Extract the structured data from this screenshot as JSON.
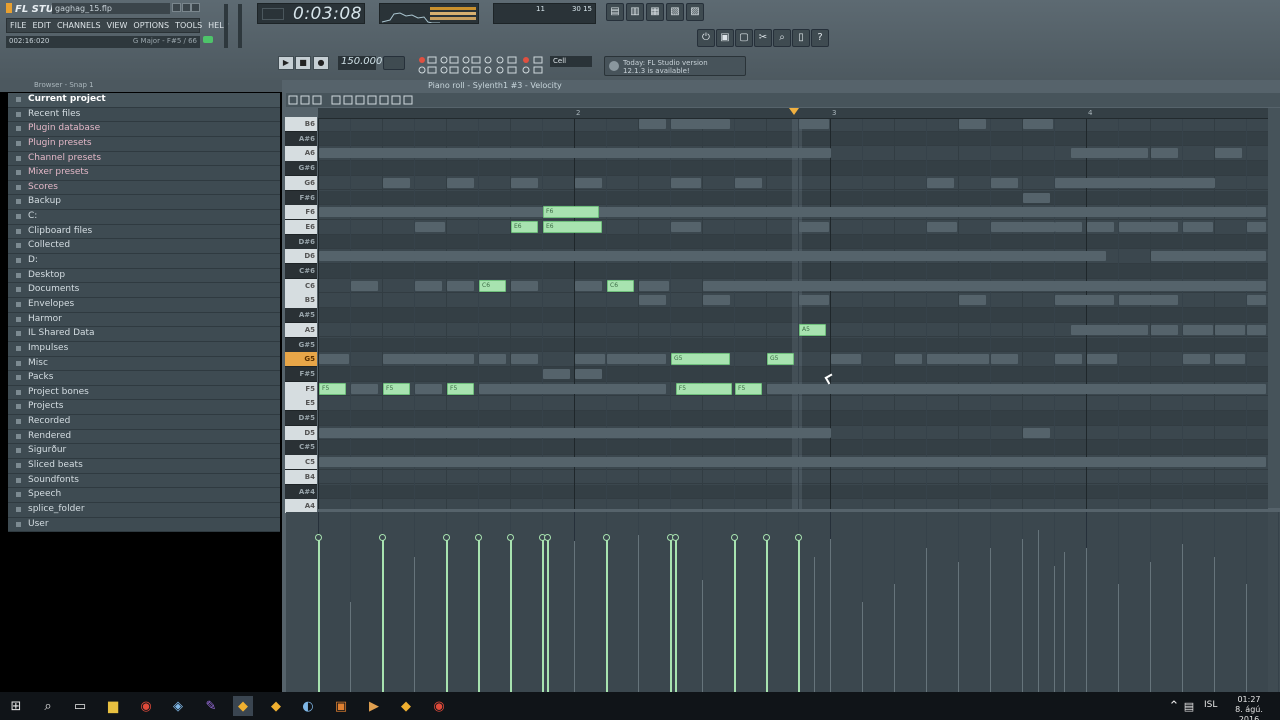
{
  "app": {
    "name": "FL STUDIO",
    "filename": "gaghag_15.flp",
    "menu": [
      "FILE",
      "EDIT",
      "CHANNELS",
      "VIEW",
      "OPTIONS",
      "TOOLS",
      "HELP"
    ],
    "hint_left": "002:16:020",
    "hint_right": "G Major - F#5 / 66",
    "time": "0:03:08",
    "cpu_val1": "30 15",
    "cpu_val2": "11",
    "tempo": "150.000",
    "snap": "Cell",
    "news_line1": "Today: FL Studio version",
    "news_line2": "12.1.3 is available!"
  },
  "browser": {
    "header": "Browser - Snap 1",
    "items": [
      {
        "label": "Current project",
        "style": "current"
      },
      {
        "label": "Recent files",
        "style": "normal"
      },
      {
        "label": "Plugin database",
        "style": "magenta"
      },
      {
        "label": "Plugin presets",
        "style": "magenta"
      },
      {
        "label": "Channel presets",
        "style": "magenta"
      },
      {
        "label": "Mixer presets",
        "style": "magenta"
      },
      {
        "label": "Scores",
        "style": "magenta"
      },
      {
        "label": "Backup",
        "style": "normal"
      },
      {
        "label": "C:",
        "style": "normal"
      },
      {
        "label": "Clipboard files",
        "style": "normal"
      },
      {
        "label": "Collected",
        "style": "normal"
      },
      {
        "label": "D:",
        "style": "normal"
      },
      {
        "label": "Desktop",
        "style": "normal"
      },
      {
        "label": "Documents",
        "style": "normal"
      },
      {
        "label": "Envelopes",
        "style": "normal"
      },
      {
        "label": "Harmor",
        "style": "normal"
      },
      {
        "label": "IL Shared Data",
        "style": "normal"
      },
      {
        "label": "Impulses",
        "style": "normal"
      },
      {
        "label": "Misc",
        "style": "normal"
      },
      {
        "label": "Packs",
        "style": "normal"
      },
      {
        "label": "Project bones",
        "style": "normal"
      },
      {
        "label": "Projects",
        "style": "normal"
      },
      {
        "label": "Recorded",
        "style": "normal"
      },
      {
        "label": "Rendered",
        "style": "normal"
      },
      {
        "label": "Sigurður",
        "style": "normal"
      },
      {
        "label": "Sliced beats",
        "style": "normal"
      },
      {
        "label": "Soundfonts",
        "style": "normal"
      },
      {
        "label": "Speech",
        "style": "normal"
      },
      {
        "label": "splice_folder",
        "style": "normal"
      },
      {
        "label": "User",
        "style": "normal"
      }
    ]
  },
  "piano_roll": {
    "title": "Piano roll - Sylenth1 #3 - Velocity",
    "ruler_marks": [
      "2",
      "3",
      "4"
    ],
    "keys": [
      {
        "label": "B6",
        "type": "w"
      },
      {
        "label": "A#6",
        "type": "b"
      },
      {
        "label": "A6",
        "type": "w"
      },
      {
        "label": "G#6",
        "type": "b"
      },
      {
        "label": "G6",
        "type": "w"
      },
      {
        "label": "F#6",
        "type": "b"
      },
      {
        "label": "F6",
        "type": "w"
      },
      {
        "label": "E6",
        "type": "w"
      },
      {
        "label": "D#6",
        "type": "b"
      },
      {
        "label": "D6",
        "type": "w"
      },
      {
        "label": "C#6",
        "type": "b"
      },
      {
        "label": "C6",
        "type": "w"
      },
      {
        "label": "B5",
        "type": "w"
      },
      {
        "label": "A#5",
        "type": "b"
      },
      {
        "label": "A5",
        "type": "w"
      },
      {
        "label": "G#5",
        "type": "b"
      },
      {
        "label": "G5",
        "type": "hl"
      },
      {
        "label": "F#5",
        "type": "b"
      },
      {
        "label": "F5",
        "type": "w"
      },
      {
        "label": "E5",
        "type": "w"
      },
      {
        "label": "D#5",
        "type": "b"
      },
      {
        "label": "D5",
        "type": "w"
      },
      {
        "label": "C#5",
        "type": "b"
      },
      {
        "label": "C5",
        "type": "w"
      },
      {
        "label": "B4",
        "type": "w"
      },
      {
        "label": "A#4",
        "type": "b"
      },
      {
        "label": "A4",
        "type": "w"
      }
    ],
    "notes": [
      {
        "label": "F5",
        "row": 18,
        "start": 0,
        "len": 0.85
      },
      {
        "label": "F5",
        "row": 18,
        "start": 2,
        "len": 0.85
      },
      {
        "label": "F5",
        "row": 18,
        "start": 4,
        "len": 0.85
      },
      {
        "label": "C6",
        "row": 11,
        "start": 5,
        "len": 0.85
      },
      {
        "label": "E6",
        "row": 7,
        "start": 6,
        "len": 0.85
      },
      {
        "label": "F6",
        "row": 6,
        "start": 7,
        "len": 1.75
      },
      {
        "label": "E6",
        "row": 7,
        "start": 7,
        "len": 1.85
      },
      {
        "label": "C6",
        "row": 11,
        "start": 9,
        "len": 0.85
      },
      {
        "label": "G5",
        "row": 16,
        "start": 11,
        "len": 1.85
      },
      {
        "label": "F5",
        "row": 18,
        "start": 11.15,
        "len": 1.75
      },
      {
        "label": "F5",
        "row": 18,
        "start": 13,
        "len": 0.85
      },
      {
        "label": "G5",
        "row": 16,
        "start": 14,
        "len": 0.85
      },
      {
        "label": "A5",
        "row": 14,
        "start": 15,
        "len": 0.85
      }
    ],
    "ghost_notes": [
      {
        "row": 0,
        "start": 10,
        "len": 0.85
      },
      {
        "row": 0,
        "start": 11,
        "len": 1.85
      },
      {
        "row": 0,
        "start": 15,
        "len": 0.95
      },
      {
        "row": 0,
        "start": 20,
        "len": 0.85
      },
      {
        "row": 0,
        "start": 22,
        "len": 0.95
      },
      {
        "row": 2,
        "start": 0,
        "len": 16
      },
      {
        "row": 2,
        "start": 23.5,
        "len": 2.4
      },
      {
        "row": 2,
        "start": 26,
        "len": 0.85
      },
      {
        "row": 2,
        "start": 28,
        "len": 0.85
      },
      {
        "row": 4,
        "start": 2,
        "len": 0.85
      },
      {
        "row": 4,
        "start": 4,
        "len": 0.85
      },
      {
        "row": 4,
        "start": 6,
        "len": 0.85
      },
      {
        "row": 4,
        "start": 8,
        "len": 0.85
      },
      {
        "row": 4,
        "start": 11,
        "len": 0.95
      },
      {
        "row": 4,
        "start": 13,
        "len": 0.85
      },
      {
        "row": 4,
        "start": 19,
        "len": 0.85
      },
      {
        "row": 4,
        "start": 21,
        "len": 0.85
      },
      {
        "row": 4,
        "start": 23,
        "len": 5
      },
      {
        "row": 5,
        "start": 22,
        "len": 0.85
      },
      {
        "row": 6,
        "start": 0,
        "len": 29.6
      },
      {
        "row": 7,
        "start": 3,
        "len": 0.95
      },
      {
        "row": 7,
        "start": 11,
        "len": 0.95
      },
      {
        "row": 7,
        "start": 15,
        "len": 0.95
      },
      {
        "row": 7,
        "start": 19,
        "len": 0.95
      },
      {
        "row": 7,
        "start": 21,
        "len": 2
      },
      {
        "row": 7,
        "start": 23,
        "len": 0.85
      },
      {
        "row": 7,
        "start": 24,
        "len": 0.85
      },
      {
        "row": 7,
        "start": 25,
        "len": 1.85
      },
      {
        "row": 7,
        "start": 27,
        "len": 0.95
      },
      {
        "row": 7,
        "start": 29,
        "len": 0.6
      },
      {
        "row": 9,
        "start": 0,
        "len": 24.6
      },
      {
        "row": 9,
        "start": 26,
        "len": 3.6
      },
      {
        "row": 11,
        "start": 1,
        "len": 0.85
      },
      {
        "row": 11,
        "start": 3,
        "len": 0.85
      },
      {
        "row": 11,
        "start": 4,
        "len": 0.85
      },
      {
        "row": 11,
        "start": 6,
        "len": 0.85
      },
      {
        "row": 11,
        "start": 8,
        "len": 0.85
      },
      {
        "row": 11,
        "start": 10,
        "len": 0.95
      },
      {
        "row": 11,
        "start": 12,
        "len": 17.6
      },
      {
        "row": 12,
        "start": 10,
        "len": 0.85
      },
      {
        "row": 12,
        "start": 12,
        "len": 0.85
      },
      {
        "row": 12,
        "start": 15,
        "len": 0.95
      },
      {
        "row": 12,
        "start": 20,
        "len": 0.85
      },
      {
        "row": 12,
        "start": 23,
        "len": 1.85
      },
      {
        "row": 12,
        "start": 25,
        "len": 1.85
      },
      {
        "row": 12,
        "start": 29,
        "len": 0.6
      },
      {
        "row": 14,
        "start": 23.5,
        "len": 2.4
      },
      {
        "row": 14,
        "start": 26,
        "len": 0.85
      },
      {
        "row": 14,
        "start": 27,
        "len": 0.95
      },
      {
        "row": 14,
        "start": 28,
        "len": 0.95
      },
      {
        "row": 14,
        "start": 29,
        "len": 0.6
      },
      {
        "row": 16,
        "start": 0,
        "len": 0.95
      },
      {
        "row": 16,
        "start": 2,
        "len": 2.85
      },
      {
        "row": 16,
        "start": 5,
        "len": 0.85
      },
      {
        "row": 16,
        "start": 6,
        "len": 0.85
      },
      {
        "row": 16,
        "start": 8,
        "len": 0.95
      },
      {
        "row": 16,
        "start": 9,
        "len": 1.85
      },
      {
        "row": 16,
        "start": 16,
        "len": 0.95
      },
      {
        "row": 16,
        "start": 18,
        "len": 0.85
      },
      {
        "row": 16,
        "start": 19,
        "len": 1.95
      },
      {
        "row": 16,
        "start": 21,
        "len": 0.85
      },
      {
        "row": 16,
        "start": 23,
        "len": 0.85
      },
      {
        "row": 16,
        "start": 24,
        "len": 0.95
      },
      {
        "row": 16,
        "start": 27,
        "len": 0.85
      },
      {
        "row": 16,
        "start": 28,
        "len": 0.95
      },
      {
        "row": 17,
        "start": 7,
        "len": 0.85
      },
      {
        "row": 17,
        "start": 8,
        "len": 0.85
      },
      {
        "row": 18,
        "start": 1,
        "len": 0.85
      },
      {
        "row": 18,
        "start": 3,
        "len": 0.85
      },
      {
        "row": 18,
        "start": 5,
        "len": 5.85
      },
      {
        "row": 18,
        "start": 14,
        "len": 15.6
      },
      {
        "row": 21,
        "start": 0,
        "len": 16
      },
      {
        "row": 21,
        "start": 22,
        "len": 0.85
      },
      {
        "row": 23,
        "start": 0,
        "len": 29.6
      }
    ],
    "velocity": [
      {
        "pos": 0,
        "level": 0.86
      },
      {
        "pos": 2,
        "level": 0.86
      },
      {
        "pos": 4,
        "level": 0.86
      },
      {
        "pos": 5,
        "level": 0.86
      },
      {
        "pos": 6,
        "level": 0.86
      },
      {
        "pos": 7,
        "level": 0.86
      },
      {
        "pos": 7.15,
        "level": 0.86
      },
      {
        "pos": 9,
        "level": 0.86
      },
      {
        "pos": 11,
        "level": 0.86
      },
      {
        "pos": 11.15,
        "level": 0.86
      },
      {
        "pos": 13,
        "level": 0.86
      },
      {
        "pos": 14,
        "level": 0.86
      },
      {
        "pos": 15,
        "level": 0.86
      }
    ],
    "velocity_ghost": [
      {
        "pos": 1,
        "level": 0.5
      },
      {
        "pos": 3,
        "level": 0.75
      },
      {
        "pos": 8,
        "level": 0.84
      },
      {
        "pos": 10,
        "level": 0.87
      },
      {
        "pos": 12,
        "level": 0.62
      },
      {
        "pos": 15.5,
        "level": 0.75
      },
      {
        "pos": 16,
        "level": 0.85
      },
      {
        "pos": 17,
        "level": 0.5
      },
      {
        "pos": 18,
        "level": 0.6
      },
      {
        "pos": 19,
        "level": 0.8
      },
      {
        "pos": 20,
        "level": 0.72
      },
      {
        "pos": 21,
        "level": 0.8
      },
      {
        "pos": 22,
        "level": 0.85
      },
      {
        "pos": 22.5,
        "level": 0.9
      },
      {
        "pos": 23,
        "level": 0.7
      },
      {
        "pos": 23.3,
        "level": 0.78
      },
      {
        "pos": 24,
        "level": 0.8
      },
      {
        "pos": 25,
        "level": 0.6
      },
      {
        "pos": 26,
        "level": 0.72
      },
      {
        "pos": 27,
        "level": 0.82
      },
      {
        "pos": 28,
        "level": 0.75
      },
      {
        "pos": 29,
        "level": 0.6
      }
    ]
  },
  "taskbar": {
    "lang": "ISL",
    "time": "01:27",
    "date": "8. ágú. 2016"
  }
}
